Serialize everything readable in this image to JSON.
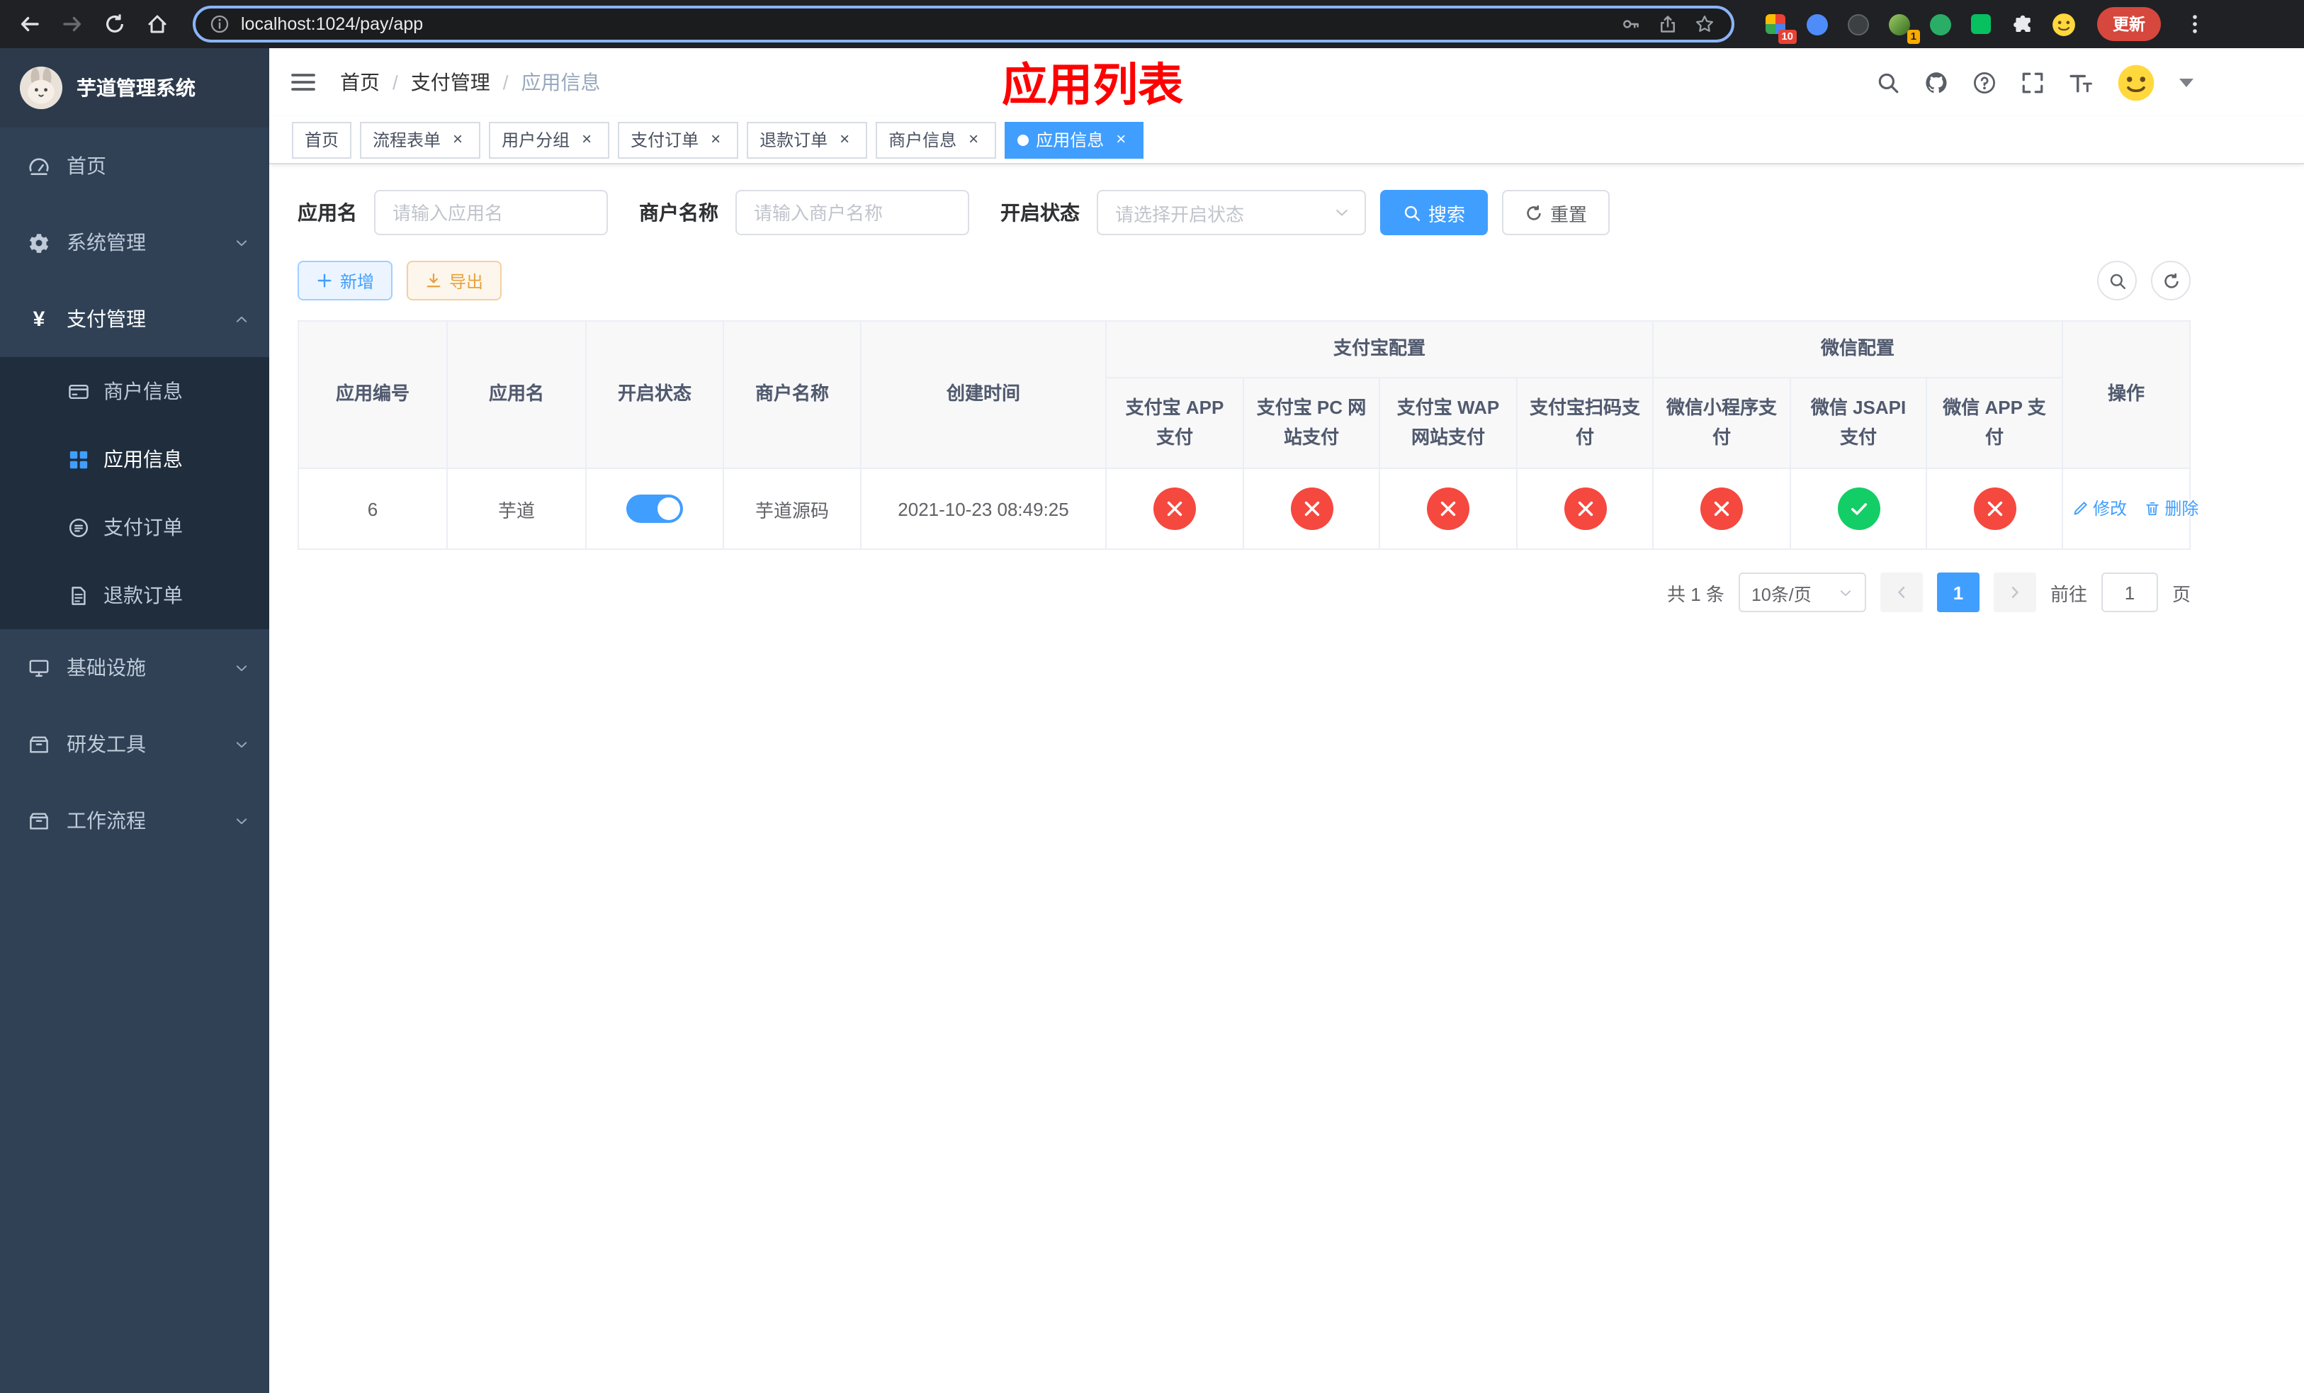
{
  "colors": {
    "accent": "#409eff",
    "title_red": "#ff0000",
    "success": "#13ce66",
    "danger": "#f5483f"
  },
  "browser": {
    "url": "localhost:1024/pay/app",
    "update_button": "更新",
    "extension_badge_a": "10",
    "extension_badge_b": "1"
  },
  "sidebar": {
    "title": "芋道管理系统",
    "items": {
      "home": "首页",
      "system": "系统管理",
      "pay": "支付管理",
      "infra": "基础设施",
      "devtools": "研发工具",
      "workflow": "工作流程"
    },
    "pay_children": {
      "merchant": "商户信息",
      "app": "应用信息",
      "order": "支付订单",
      "refund": "退款订单"
    }
  },
  "header": {
    "breadcrumb": [
      "首页",
      "支付管理",
      "应用信息"
    ],
    "title": "应用列表"
  },
  "tabs": [
    {
      "label": "首页"
    },
    {
      "label": "流程表单"
    },
    {
      "label": "用户分组"
    },
    {
      "label": "支付订单"
    },
    {
      "label": "退款订单"
    },
    {
      "label": "商户信息"
    },
    {
      "label": "应用信息"
    }
  ],
  "filters": {
    "app_name": {
      "label": "应用名",
      "placeholder": "请输入应用名",
      "value": ""
    },
    "merchant_name": {
      "label": "商户名称",
      "placeholder": "请输入商户名称",
      "value": ""
    },
    "status": {
      "label": "开启状态",
      "placeholder": "请选择开启状态",
      "value": ""
    },
    "search": "搜索",
    "reset": "重置"
  },
  "toolbar": {
    "add": "新增",
    "export": "导出"
  },
  "table": {
    "columns": {
      "id": "应用编号",
      "name": "应用名",
      "status": "开启状态",
      "merchant": "商户名称",
      "created": "创建时间",
      "alipay_group": "支付宝配置",
      "wechat_group": "微信配置",
      "alipay_app": "支付宝 APP 支付",
      "alipay_pc": "支付宝 PC 网站支付",
      "alipay_wap": "支付宝 WAP 网站支付",
      "alipay_qr": "支付宝扫码支付",
      "wx_lite": "微信小程序支付",
      "wx_jsapi": "微信 JSAPI 支付",
      "wx_app": "微信 APP 支付",
      "actions": "操作"
    },
    "row": {
      "id": "6",
      "name": "芋道",
      "enabled": true,
      "merchant": "芋道源码",
      "created": "2021-10-23 08:49:25",
      "configs": [
        "deny",
        "deny",
        "deny",
        "deny",
        "deny",
        "allow",
        "deny"
      ],
      "edit": "修改",
      "delete": "删除"
    }
  },
  "pagination": {
    "total": "共 1 条",
    "page_size": "10条/页",
    "current_page": "1",
    "goto_label": "前往",
    "goto_value": "1",
    "page_suffix": "页"
  }
}
